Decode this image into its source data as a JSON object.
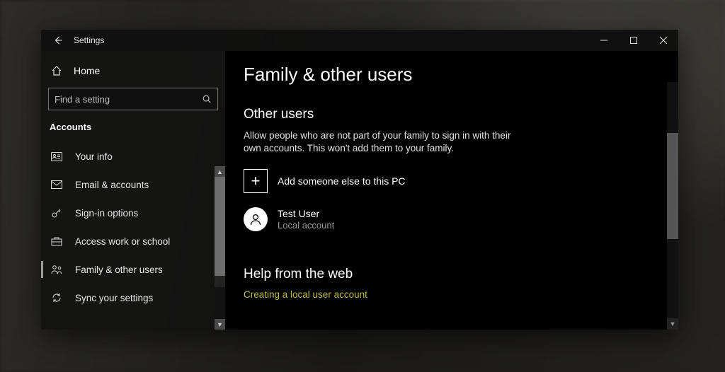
{
  "window": {
    "title": "Settings"
  },
  "sidebar": {
    "home_label": "Home",
    "search_placeholder": "Find a setting",
    "category": "Accounts",
    "items": [
      {
        "label": "Your info"
      },
      {
        "label": "Email & accounts"
      },
      {
        "label": "Sign-in options"
      },
      {
        "label": "Access work or school"
      },
      {
        "label": "Family & other users"
      },
      {
        "label": "Sync your settings"
      }
    ]
  },
  "content": {
    "page_title": "Family & other users",
    "other_users": {
      "title": "Other users",
      "description": "Allow people who are not part of your family to sign in with their own accounts. This won't add them to your family.",
      "add_label": "Add someone else to this PC",
      "users": [
        {
          "name": "Test User",
          "type": "Local account"
        }
      ]
    },
    "help": {
      "title": "Help from the web",
      "links": [
        "Creating a local user account"
      ]
    }
  }
}
